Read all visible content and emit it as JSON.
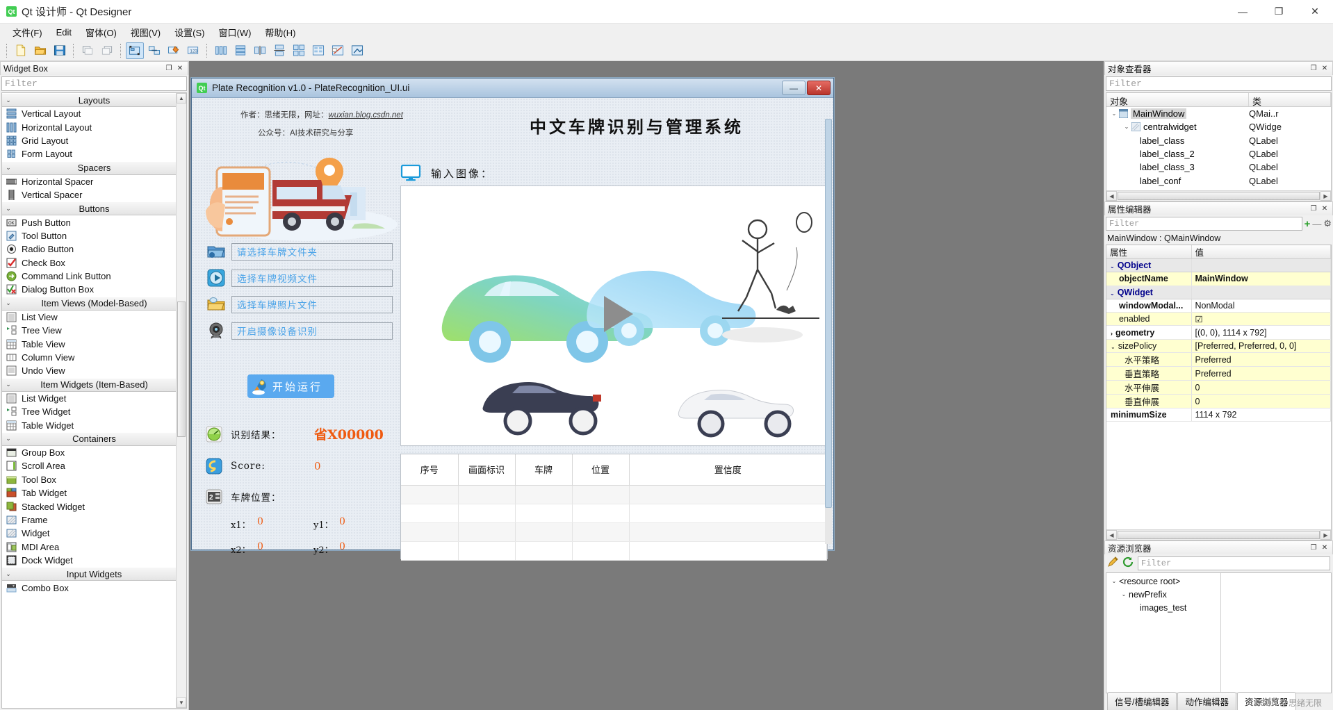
{
  "app": {
    "title": "Qt 设计师 - Qt Designer",
    "logo": "Qt",
    "window_controls": {
      "minimize": "—",
      "maximize": "❐",
      "close": "✕"
    }
  },
  "menubar": [
    {
      "label": "文件(F)"
    },
    {
      "label": "Edit"
    },
    {
      "label": "窗体(O)"
    },
    {
      "label": "视图(V)"
    },
    {
      "label": "设置(S)"
    },
    {
      "label": "窗口(W)"
    },
    {
      "label": "帮助(H)"
    }
  ],
  "widget_box": {
    "dock_title": "Widget Box",
    "filter_placeholder": "Filter",
    "float_btn": "❐",
    "close_btn": "✕",
    "groups": [
      {
        "name": "Layouts",
        "chevron": "⌄",
        "items": [
          {
            "label": "Vertical Layout",
            "icon": "vertical-layout-icon"
          },
          {
            "label": "Horizontal Layout",
            "icon": "horizontal-layout-icon"
          },
          {
            "label": "Grid Layout",
            "icon": "grid-layout-icon"
          },
          {
            "label": "Form Layout",
            "icon": "form-layout-icon"
          }
        ]
      },
      {
        "name": "Spacers",
        "chevron": "⌄",
        "items": [
          {
            "label": "Horizontal Spacer",
            "icon": "horizontal-spacer-icon"
          },
          {
            "label": "Vertical Spacer",
            "icon": "vertical-spacer-icon"
          }
        ]
      },
      {
        "name": "Buttons",
        "chevron": "⌄",
        "items": [
          {
            "label": "Push Button",
            "icon": "push-button-icon"
          },
          {
            "label": "Tool Button",
            "icon": "tool-button-icon"
          },
          {
            "label": "Radio Button",
            "icon": "radio-button-icon"
          },
          {
            "label": "Check Box",
            "icon": "check-box-icon"
          },
          {
            "label": "Command Link Button",
            "icon": "command-link-button-icon"
          },
          {
            "label": "Dialog Button Box",
            "icon": "dialog-button-box-icon"
          }
        ]
      },
      {
        "name": "Item Views (Model-Based)",
        "chevron": "⌄",
        "items": [
          {
            "label": "List View",
            "icon": "list-view-icon"
          },
          {
            "label": "Tree View",
            "icon": "tree-view-icon"
          },
          {
            "label": "Table View",
            "icon": "table-view-icon"
          },
          {
            "label": "Column View",
            "icon": "column-view-icon"
          },
          {
            "label": "Undo View",
            "icon": "undo-view-icon"
          }
        ]
      },
      {
        "name": "Item Widgets (Item-Based)",
        "chevron": "⌄",
        "items": [
          {
            "label": "List Widget",
            "icon": "list-widget-icon"
          },
          {
            "label": "Tree Widget",
            "icon": "tree-widget-icon"
          },
          {
            "label": "Table Widget",
            "icon": "table-widget-icon"
          }
        ]
      },
      {
        "name": "Containers",
        "chevron": "⌄",
        "items": [
          {
            "label": "Group Box",
            "icon": "group-box-icon"
          },
          {
            "label": "Scroll Area",
            "icon": "scroll-area-icon"
          },
          {
            "label": "Tool Box",
            "icon": "tool-box-icon"
          },
          {
            "label": "Tab Widget",
            "icon": "tab-widget-icon"
          },
          {
            "label": "Stacked Widget",
            "icon": "stacked-widget-icon"
          },
          {
            "label": "Frame",
            "icon": "frame-icon"
          },
          {
            "label": "Widget",
            "icon": "widget-icon"
          },
          {
            "label": "MDI Area",
            "icon": "mdi-area-icon"
          },
          {
            "label": "Dock Widget",
            "icon": "dock-widget-icon"
          }
        ]
      },
      {
        "name": "Input Widgets",
        "chevron": "⌄",
        "items": [
          {
            "label": "Combo Box",
            "icon": "combo-box-icon"
          }
        ]
      }
    ]
  },
  "form": {
    "title": "Plate Recognition v1.0 - PlateRecognition_UI.ui",
    "logo": "Qt",
    "minimize": "—",
    "close": "✕",
    "credit_author": "作者：思绪无限，网址：",
    "credit_link": "wuxian.blog.csdn.net",
    "credit_wechat": "公众号：AI技术研究与分享",
    "heading": "中文车牌识别与管理系统",
    "input_label": "输入图像：",
    "buttons": [
      {
        "label": "请选择车牌文件夹",
        "icon": "folder-select-icon"
      },
      {
        "label": "选择车牌视频文件",
        "icon": "video-play-icon"
      },
      {
        "label": "选择车牌照片文件",
        "icon": "open-folder-icon"
      },
      {
        "label": "开启摄像设备识别",
        "icon": "webcam-icon"
      }
    ],
    "run_button": {
      "label": "开始运行",
      "icon": "rocket-icon"
    },
    "results": {
      "plate_label": "识别结果：",
      "plate_value": "省X00000",
      "plate_icon": "radar-icon",
      "score_label": "Score:",
      "score_value": "0",
      "score_icon": "score-icon",
      "position_label": "车牌位置：",
      "position_icon": "position-icon",
      "coords": [
        {
          "label": "x1：",
          "value": "0"
        },
        {
          "label": "y1：",
          "value": "0"
        },
        {
          "label": "x2：",
          "value": "0"
        },
        {
          "label": "y2：",
          "value": "0"
        }
      ]
    },
    "table": {
      "headers": [
        "序号",
        "画面标识",
        "车牌",
        "位置",
        "置信度"
      ],
      "rows": [
        [
          "",
          "",
          "",
          "",
          ""
        ],
        [
          "",
          "",
          "",
          "",
          ""
        ],
        [
          "",
          "",
          "",
          "",
          ""
        ],
        [
          "",
          "",
          "",
          "",
          ""
        ]
      ]
    }
  },
  "object_inspector": {
    "dock_title": "对象查看器",
    "float_btn": "❐",
    "close_btn": "✕",
    "filter_placeholder": "Filter",
    "columns": [
      "对象",
      "类"
    ],
    "rows": [
      {
        "indent": 0,
        "chevron": "⌄",
        "name": "MainWindow",
        "class": "QMai..r",
        "selected": true,
        "icon": "window-icon"
      },
      {
        "indent": 1,
        "chevron": "⌄",
        "name": "centralwidget",
        "class": "QWidge",
        "icon": "widget-icon"
      },
      {
        "indent": 2,
        "chevron": "",
        "name": "label_class",
        "class": "QLabel",
        "icon": ""
      },
      {
        "indent": 2,
        "chevron": "",
        "name": "label_class_2",
        "class": "QLabel",
        "icon": ""
      },
      {
        "indent": 2,
        "chevron": "",
        "name": "label_class_3",
        "class": "QLabel",
        "icon": ""
      },
      {
        "indent": 2,
        "chevron": "",
        "name": "label_conf",
        "class": "QLabel",
        "icon": ""
      }
    ]
  },
  "property_editor": {
    "dock_title": "属性编辑器",
    "float_btn": "❐",
    "close_btn": "✕",
    "filter_placeholder": "Filter",
    "add_btn": "+",
    "remove_btn": "—",
    "config_btn": "⚙",
    "object_line": "MainWindow : QMainWindow",
    "columns": [
      "属性",
      "值"
    ],
    "rows": [
      {
        "type": "group",
        "name": "QObject",
        "value": "",
        "chevron": "⌄"
      },
      {
        "type": "prop",
        "name": "objectName",
        "value": "MainWindow",
        "bold": true,
        "highlight": true
      },
      {
        "type": "group",
        "name": "QWidget",
        "value": "",
        "chevron": "⌄"
      },
      {
        "type": "prop",
        "name": "windowModal...",
        "value": "NonModal",
        "bold": true,
        "highlight": false
      },
      {
        "type": "prop",
        "name": "enabled",
        "value": "☑",
        "bold": false,
        "highlight": true
      },
      {
        "type": "prop",
        "name": "geometry",
        "value": "[(0, 0), 1114 x 792]",
        "bold": true,
        "chevron": "›",
        "highlight": false
      },
      {
        "type": "prop",
        "name": "sizePolicy",
        "value": "[Preferred, Preferred, 0, 0]",
        "bold": false,
        "chevron": "⌄",
        "highlight": true
      },
      {
        "type": "sub",
        "name": "水平策略",
        "value": "Preferred",
        "highlight": true
      },
      {
        "type": "sub",
        "name": "垂直策略",
        "value": "Preferred",
        "highlight": true
      },
      {
        "type": "sub",
        "name": "水平伸展",
        "value": "0",
        "highlight": true
      },
      {
        "type": "sub",
        "name": "垂直伸展",
        "value": "0",
        "highlight": true
      },
      {
        "type": "prop",
        "name": "minimumSize",
        "value": "1114 x 792",
        "bold": true,
        "highlight": false
      }
    ]
  },
  "resource_browser": {
    "dock_title": "资源浏览器",
    "float_btn": "❐",
    "close_btn": "✕",
    "edit_icon": "pencil-icon",
    "reload_icon": "refresh-icon",
    "filter_placeholder": "Filter",
    "tree": [
      {
        "indent": 0,
        "chevron": "⌄",
        "label": "<resource root>"
      },
      {
        "indent": 1,
        "chevron": "⌄",
        "label": "newPrefix"
      },
      {
        "indent": 2,
        "chevron": "",
        "label": "images_test"
      }
    ]
  },
  "status_tabs": [
    {
      "label": "信号/槽编辑器",
      "selected": false
    },
    {
      "label": "动作编辑器",
      "selected": false
    },
    {
      "label": "资源浏览器",
      "selected": true
    }
  ],
  "watermark": "CSDN @思绪无限",
  "colors": {
    "accent": "#5aa9ef",
    "value_orange": "#ef5a10",
    "link_blue": "#4aa3e8",
    "select_gray": "#d6d6d6",
    "highlight_yellow": "#ffffd0"
  }
}
